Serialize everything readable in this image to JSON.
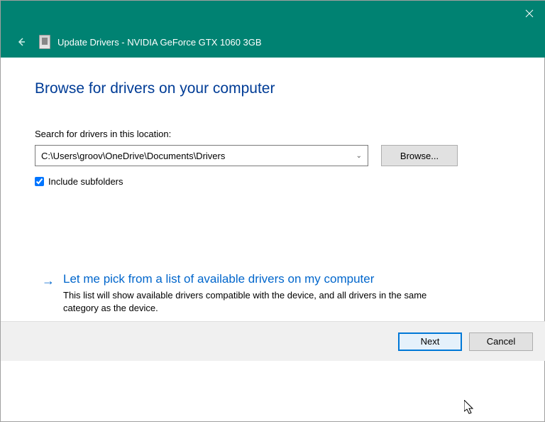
{
  "titlebar": {
    "close_tooltip": "Close"
  },
  "header": {
    "back_tooltip": "Back",
    "title": "Update Drivers - NVIDIA GeForce GTX 1060 3GB"
  },
  "content": {
    "heading": "Browse for drivers on your computer",
    "search_label": "Search for drivers in this location:",
    "path_value": "C:\\Users\\groov\\OneDrive\\Documents\\Drivers",
    "browse_button": "Browse...",
    "include_subfolders_label": "Include subfolders",
    "include_subfolders_checked": true,
    "option": {
      "title": "Let me pick from a list of available drivers on my computer",
      "description": "This list will show available drivers compatible with the device, and all drivers in the same category as the device."
    }
  },
  "footer": {
    "next": "Next",
    "cancel": "Cancel"
  }
}
